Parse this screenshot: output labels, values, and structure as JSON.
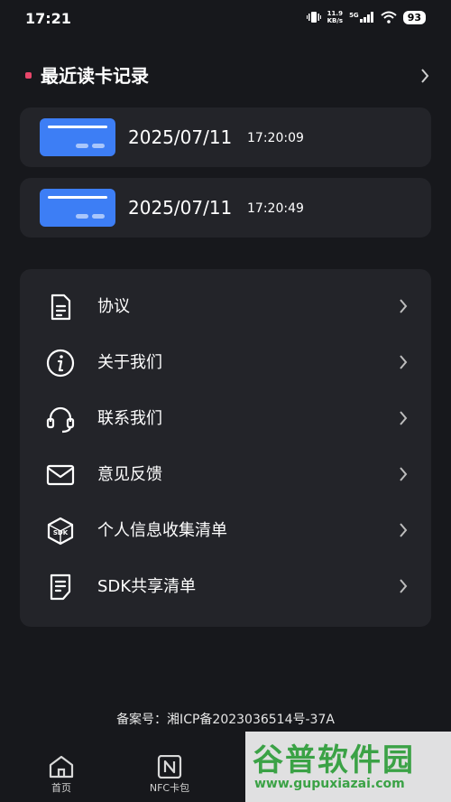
{
  "status_bar": {
    "time": "17:21",
    "net_speed_value": "11.9",
    "net_speed_unit": "KB/s",
    "network_type": "5G",
    "battery": "93"
  },
  "recent": {
    "title": "最近读卡记录",
    "records": [
      {
        "date": "2025/07/11",
        "time": "17:20:09"
      },
      {
        "date": "2025/07/11",
        "time": "17:20:49"
      }
    ]
  },
  "menu": {
    "items": [
      {
        "label": "协议",
        "icon": "document-icon"
      },
      {
        "label": "关于我们",
        "icon": "info-icon"
      },
      {
        "label": "联系我们",
        "icon": "headset-icon"
      },
      {
        "label": "意见反馈",
        "icon": "mail-icon"
      },
      {
        "label": "个人信息收集清单",
        "icon": "sdk-cube-icon"
      },
      {
        "label": "SDK共享清单",
        "icon": "list-document-icon"
      }
    ]
  },
  "footer": {
    "filing": "备案号：湘ICP备2023036514号-37A"
  },
  "tabs": [
    {
      "label": "首页",
      "icon": "home-icon"
    },
    {
      "label": "NFC卡包",
      "icon": "nfc-icon"
    }
  ],
  "watermark": {
    "title": "谷普软件园",
    "url": "www.gupuxiazai.com"
  },
  "colors": {
    "background": "#17181c",
    "card": "#232429",
    "accent": "#e8466a",
    "card_blue": "#3d7ef5"
  }
}
